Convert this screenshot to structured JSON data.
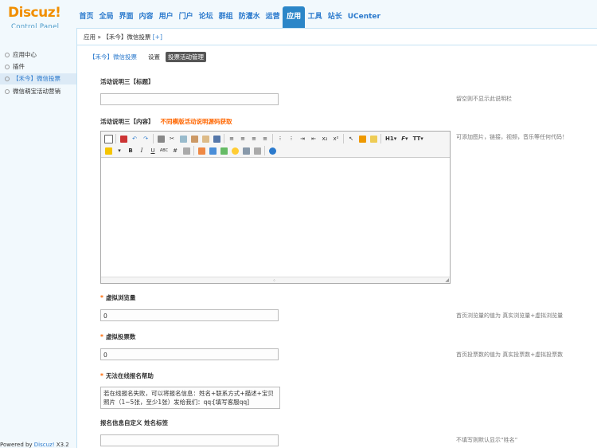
{
  "logo": {
    "brand": "Discuz",
    "bang": "!",
    "sub": "Control Panel"
  },
  "nav": [
    "首页",
    "全局",
    "界面",
    "内容",
    "用户",
    "门户",
    "论坛",
    "群组",
    "防灌水",
    "运营",
    "应用",
    "工具",
    "站长",
    "UCenter"
  ],
  "nav_active": "应用",
  "sidebar": {
    "items": [
      "应用中心",
      "插件",
      "【禾今】微信投票",
      "微信萌宝活动营销"
    ],
    "selected": "【禾今】微信投票"
  },
  "powered": {
    "text": "Powered by ",
    "link": "Discuz!",
    "version": " X3.2"
  },
  "breadcrumb": {
    "text": "应用 » 【禾今】微信投票",
    "plus": "[+]"
  },
  "subtabs": {
    "title": "【禾今】微信投票",
    "tabs": [
      "设置",
      "投票活动管理"
    ],
    "active": "投票活动管理"
  },
  "fields": {
    "desc_title": {
      "label": "活动说明三【标题】",
      "value": "",
      "tip": "留空则不显示此说明栏"
    },
    "desc_content": {
      "label": "活动说明三【内容】",
      "link": "不同模版活动说明源码获取",
      "tip": "可添加图片，链接，视频，音乐等任何代码！"
    },
    "virtual_views": {
      "label": "虚拟浏览量",
      "value": "0",
      "tip": "首页浏览量的值为 真实浏览量+虚拟浏览量"
    },
    "virtual_votes": {
      "label": "虚拟投票数",
      "value": "0",
      "tip": "首页投票数的值为 真实投票数+虚拟投票数"
    },
    "cannot_signup": {
      "label": "无法在线报名帮助",
      "value": "若在线报名失败，可以将报名信息：姓名+联系方式+描述+宝贝照片（1~5张，至少1张）发给我们：qq:[填写客服qq]"
    },
    "name_label": {
      "label": "报名信息自定义 姓名标签",
      "value": "",
      "tip": "不填写则默认显示“姓名”"
    }
  },
  "editor_toolbar": {
    "h1": "H1",
    "font": "F",
    "size": "TT"
  }
}
